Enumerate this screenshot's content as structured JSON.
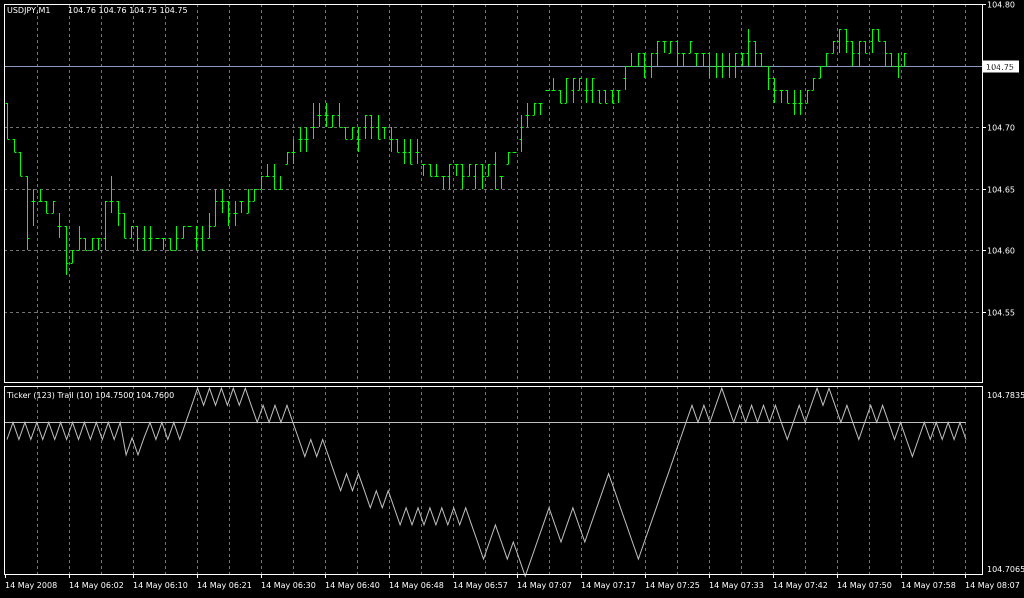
{
  "header": {
    "symbol": "USDJPY,M1",
    "ohlc": "104.76 104.76 104.75 104.75"
  },
  "indicator": {
    "label": "Ticker (123) Trail (10) 104.7500 104.7600"
  },
  "colors": {
    "background": "#000000",
    "frame": "#ffffff",
    "grid": "#c0c0c0",
    "bars": "#00ff00",
    "price_line": "#8899bb",
    "indicator_line": "#c0c0c0",
    "trail_line": "#c0c0c0",
    "text": "#ffffff",
    "price_marker_bg": "#ffffff",
    "price_marker_text": "#000000"
  },
  "chart_data": [
    {
      "type": "ohlc",
      "price_labels": [
        "104.80",
        "104.75",
        "104.70",
        "104.65",
        "104.60",
        "104.55"
      ],
      "price_ticks": [
        104.8,
        104.75,
        104.7,
        104.65,
        104.6,
        104.55
      ],
      "current_price": {
        "value": 104.75,
        "label": "104.75"
      },
      "ylim": [
        104.493,
        104.8
      ],
      "time_labels": [
        "14 May 2008",
        "14 May 06:02",
        "14 May 06:10",
        "14 May 06:21",
        "14 May 06:30",
        "14 May 06:40",
        "14 May 06:48",
        "14 May 06:57",
        "14 May 07:07",
        "14 May 07:17",
        "14 May 07:25",
        "14 May 07:33",
        "14 May 07:42",
        "14 May 07:50",
        "14 May 07:58",
        "14 May 08:07"
      ],
      "grid": true,
      "bars": [
        [
          104.72,
          104.72,
          104.69,
          104.69
        ],
        [
          104.69,
          104.69,
          104.68,
          104.68
        ],
        [
          104.68,
          104.68,
          104.66,
          104.66
        ],
        [
          104.66,
          104.66,
          104.6,
          104.61
        ],
        [
          104.64,
          104.65,
          104.62,
          104.64
        ],
        [
          104.64,
          104.65,
          104.64,
          104.64
        ],
        [
          104.64,
          104.64,
          104.63,
          104.63
        ],
        [
          104.63,
          104.64,
          104.63,
          104.64
        ],
        [
          104.62,
          104.63,
          104.61,
          104.62
        ],
        [
          104.62,
          104.62,
          104.58,
          104.59
        ],
        [
          104.59,
          104.6,
          104.59,
          104.6
        ],
        [
          104.6,
          104.62,
          104.6,
          104.61
        ],
        [
          104.61,
          104.61,
          104.6,
          104.6
        ],
        [
          104.6,
          104.61,
          104.6,
          104.61
        ],
        [
          104.61,
          104.61,
          104.6,
          104.61
        ],
        [
          104.61,
          104.64,
          104.6,
          104.64
        ],
        [
          104.64,
          104.66,
          104.63,
          104.64
        ],
        [
          104.64,
          104.64,
          104.62,
          104.63
        ],
        [
          104.63,
          104.63,
          104.61,
          104.61
        ],
        [
          104.61,
          104.62,
          104.61,
          104.62
        ],
        [
          104.62,
          104.62,
          104.6,
          104.61
        ],
        [
          104.61,
          104.62,
          104.6,
          104.6
        ],
        [
          104.61,
          104.62,
          104.6,
          104.61
        ],
        [
          104.61,
          104.61,
          104.61,
          104.61
        ],
        [
          104.61,
          104.61,
          104.6,
          104.61
        ],
        [
          104.61,
          104.61,
          104.6,
          104.6
        ],
        [
          104.6,
          104.62,
          104.6,
          104.61
        ],
        [
          104.61,
          104.62,
          104.61,
          104.62
        ],
        [
          104.62,
          104.62,
          104.62,
          104.62
        ],
        [
          104.61,
          104.62,
          104.6,
          104.61
        ],
        [
          104.61,
          104.62,
          104.6,
          104.6
        ],
        [
          104.61,
          104.63,
          104.61,
          104.62
        ],
        [
          104.62,
          104.65,
          104.62,
          104.64
        ],
        [
          104.64,
          104.65,
          104.63,
          104.64
        ],
        [
          104.64,
          104.64,
          104.62,
          104.63
        ],
        [
          104.63,
          104.64,
          104.62,
          104.63
        ],
        [
          104.64,
          104.64,
          104.63,
          104.64
        ],
        [
          104.63,
          104.65,
          104.63,
          104.64
        ],
        [
          104.64,
          104.65,
          104.64,
          104.65
        ],
        [
          104.65,
          104.66,
          104.65,
          104.66
        ],
        [
          104.66,
          104.67,
          104.66,
          104.66
        ],
        [
          104.66,
          104.67,
          104.65,
          104.65
        ],
        [
          104.65,
          104.66,
          104.65,
          104.65
        ],
        [
          104.67,
          104.68,
          104.67,
          104.68
        ],
        [
          104.68,
          104.69,
          104.67,
          104.68
        ],
        [
          104.69,
          104.7,
          104.68,
          104.69
        ],
        [
          104.69,
          104.7,
          104.68,
          104.69
        ],
        [
          104.7,
          104.72,
          104.69,
          104.7
        ],
        [
          104.71,
          104.72,
          104.7,
          104.71
        ],
        [
          104.71,
          104.72,
          104.7,
          104.71
        ],
        [
          104.7,
          104.71,
          104.7,
          104.71
        ],
        [
          104.71,
          104.72,
          104.7,
          104.7
        ],
        [
          104.7,
          104.7,
          104.69,
          104.69
        ],
        [
          104.69,
          104.7,
          104.69,
          104.7
        ],
        [
          104.69,
          104.7,
          104.68,
          104.69
        ],
        [
          104.7,
          104.71,
          104.69,
          104.71
        ],
        [
          104.71,
          104.71,
          104.69,
          104.7
        ],
        [
          104.7,
          104.71,
          104.69,
          104.69
        ],
        [
          104.7,
          104.7,
          104.69,
          104.7
        ],
        [
          104.69,
          104.7,
          104.68,
          104.69
        ],
        [
          104.69,
          104.69,
          104.68,
          104.68
        ],
        [
          104.68,
          104.69,
          104.67,
          104.68
        ],
        [
          104.68,
          104.69,
          104.67,
          104.67
        ],
        [
          104.68,
          104.69,
          104.67,
          104.68
        ],
        [
          104.67,
          104.67,
          104.66,
          104.67
        ],
        [
          104.67,
          104.67,
          104.66,
          104.66
        ],
        [
          104.66,
          104.67,
          104.66,
          104.66
        ],
        [
          104.66,
          104.66,
          104.65,
          104.66
        ],
        [
          104.66,
          104.67,
          104.65,
          104.67
        ],
        [
          104.67,
          104.67,
          104.66,
          104.67
        ],
        [
          104.67,
          104.67,
          104.65,
          104.66
        ],
        [
          104.66,
          104.67,
          104.66,
          104.67
        ],
        [
          104.66,
          104.67,
          104.65,
          104.67
        ],
        [
          104.67,
          104.67,
          104.65,
          104.66
        ],
        [
          104.66,
          104.67,
          104.66,
          104.67
        ],
        [
          104.67,
          104.68,
          104.65,
          104.65
        ],
        [
          104.66,
          104.66,
          104.65,
          104.66
        ],
        [
          104.67,
          104.68,
          104.67,
          104.68
        ],
        [
          104.68,
          104.68,
          104.68,
          104.68
        ],
        [
          104.69,
          104.71,
          104.68,
          104.7
        ],
        [
          104.71,
          104.72,
          104.7,
          104.71
        ],
        [
          104.71,
          104.72,
          104.71,
          104.72
        ],
        [
          104.72,
          104.72,
          104.71,
          104.72
        ],
        [
          104.73,
          104.73,
          104.73,
          104.73
        ],
        [
          104.73,
          104.74,
          104.73,
          104.73
        ],
        [
          104.73,
          104.73,
          104.72,
          104.72
        ],
        [
          104.72,
          104.74,
          104.72,
          104.74
        ],
        [
          104.73,
          104.74,
          104.72,
          104.74
        ],
        [
          104.73,
          104.74,
          104.73,
          104.74
        ],
        [
          104.73,
          104.74,
          104.72,
          104.73
        ],
        [
          104.73,
          104.74,
          104.72,
          104.74
        ],
        [
          104.73,
          104.73,
          104.72,
          104.72
        ],
        [
          104.73,
          104.73,
          104.72,
          104.72
        ],
        [
          104.73,
          104.73,
          104.72,
          104.72
        ],
        [
          104.73,
          104.73,
          104.72,
          104.73
        ],
        [
          104.74,
          104.75,
          104.73,
          104.75
        ],
        [
          104.75,
          104.76,
          104.75,
          104.75
        ],
        [
          104.75,
          104.76,
          104.75,
          104.76
        ],
        [
          104.76,
          104.76,
          104.74,
          104.75
        ],
        [
          104.75,
          104.76,
          104.74,
          104.76
        ],
        [
          104.76,
          104.77,
          104.75,
          104.77
        ],
        [
          104.77,
          104.77,
          104.76,
          104.77
        ],
        [
          104.76,
          104.77,
          104.76,
          104.77
        ],
        [
          104.77,
          104.77,
          104.75,
          104.76
        ],
        [
          104.76,
          104.76,
          104.75,
          104.76
        ],
        [
          104.76,
          104.77,
          104.76,
          104.77
        ],
        [
          104.76,
          104.76,
          104.75,
          104.76
        ],
        [
          104.76,
          104.76,
          104.75,
          104.76
        ],
        [
          104.76,
          104.76,
          104.74,
          104.75
        ],
        [
          104.75,
          104.76,
          104.74,
          104.75
        ],
        [
          104.75,
          104.76,
          104.74,
          104.75
        ],
        [
          104.75,
          104.76,
          104.74,
          104.75
        ],
        [
          104.75,
          104.76,
          104.74,
          104.76
        ],
        [
          104.76,
          104.76,
          104.75,
          104.76
        ],
        [
          104.76,
          104.78,
          104.75,
          104.77
        ],
        [
          104.77,
          104.77,
          104.75,
          104.76
        ],
        [
          104.76,
          104.76,
          104.75,
          104.75
        ],
        [
          104.75,
          104.75,
          104.73,
          104.74
        ],
        [
          104.74,
          104.74,
          104.72,
          104.73
        ],
        [
          104.73,
          104.73,
          104.72,
          104.73
        ],
        [
          104.73,
          104.73,
          104.72,
          104.72
        ],
        [
          104.72,
          104.73,
          104.71,
          104.72
        ],
        [
          104.72,
          104.73,
          104.71,
          104.72
        ],
        [
          104.72,
          104.73,
          104.72,
          104.73
        ],
        [
          104.73,
          104.74,
          104.73,
          104.74
        ],
        [
          104.74,
          104.75,
          104.74,
          104.75
        ],
        [
          104.75,
          104.76,
          104.75,
          104.76
        ],
        [
          104.76,
          104.77,
          104.76,
          104.77
        ],
        [
          104.77,
          104.78,
          104.76,
          104.78
        ],
        [
          104.78,
          104.78,
          104.76,
          104.77
        ],
        [
          104.77,
          104.77,
          104.75,
          104.76
        ],
        [
          104.76,
          104.77,
          104.75,
          104.77
        ],
        [
          104.77,
          104.77,
          104.76,
          104.76
        ],
        [
          104.77,
          104.78,
          104.76,
          104.78
        ],
        [
          104.78,
          104.78,
          104.77,
          104.77
        ],
        [
          104.77,
          104.77,
          104.75,
          104.76
        ],
        [
          104.76,
          104.76,
          104.75,
          104.75
        ],
        [
          104.75,
          104.76,
          104.74,
          104.75
        ],
        [
          104.75,
          104.76,
          104.75,
          104.76
        ]
      ]
    },
    {
      "type": "line",
      "labels": [
        "104.7835",
        "104.7065"
      ],
      "ylim": [
        104.7065,
        104.7835
      ],
      "trail_level": 104.7686,
      "series": [
        {
          "values": [
            104.7616,
            104.7686,
            104.7616,
            104.7686,
            104.7616,
            104.7686,
            104.7616,
            104.7686,
            104.7616,
            104.7686,
            104.7616,
            104.7686,
            104.7616,
            104.7686,
            104.7616,
            104.7686,
            104.7616,
            104.7686,
            104.7616,
            104.7686,
            104.7553,
            104.7623,
            104.7553,
            104.7623,
            104.7686,
            104.7616,
            104.7686,
            104.7616,
            104.7686,
            104.7616,
            104.7686,
            104.7756,
            104.7826,
            104.7756,
            104.7826,
            104.7756,
            104.7826,
            104.7756,
            104.7826,
            104.7756,
            104.7826,
            104.7756,
            104.7686,
            104.7756,
            104.7686,
            104.7756,
            104.7686,
            104.7756,
            104.7686,
            104.7616,
            104.7546,
            104.7616,
            104.7546,
            104.7616,
            104.7546,
            104.7476,
            104.7406,
            104.7476,
            104.7406,
            104.7476,
            104.7406,
            104.7336,
            104.7406,
            104.7336,
            104.7406,
            104.7336,
            104.7266,
            104.7336,
            104.7266,
            104.7336,
            104.7266,
            104.7336,
            104.7266,
            104.7336,
            104.7266,
            104.7336,
            104.7266,
            104.7336,
            104.7266,
            104.7196,
            104.7126,
            104.7196,
            104.7266,
            104.7196,
            104.7126,
            104.7196,
            104.7126,
            104.7056,
            104.7126,
            104.7196,
            104.7266,
            104.7336,
            104.7266,
            104.7196,
            104.7266,
            104.7336,
            104.7266,
            104.7196,
            104.7266,
            104.7336,
            104.7406,
            104.7476,
            104.7406,
            104.7336,
            104.7266,
            104.7196,
            104.7126,
            104.7196,
            104.7266,
            104.7336,
            104.7406,
            104.7476,
            104.7546,
            104.7616,
            104.7686,
            104.7756,
            104.7686,
            104.7756,
            104.7686,
            104.7756,
            104.7826,
            104.7756,
            104.7686,
            104.7756,
            104.7686,
            104.7756,
            104.7686,
            104.7756,
            104.7686,
            104.7756,
            104.7686,
            104.7616,
            104.7686,
            104.7756,
            104.7686,
            104.7756,
            104.7826,
            104.7756,
            104.7826,
            104.7756,
            104.7686,
            104.7756,
            104.7686,
            104.7616,
            104.7686,
            104.7756,
            104.7686,
            104.7756,
            104.7686,
            104.7616,
            104.7686,
            104.7616,
            104.7546,
            104.7616,
            104.7686,
            104.7616,
            104.7686,
            104.7616,
            104.7686,
            104.7616,
            104.7686,
            104.7616
          ]
        }
      ]
    }
  ]
}
